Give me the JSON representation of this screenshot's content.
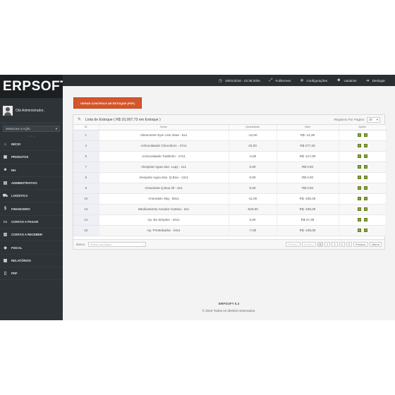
{
  "sidebar": {
    "logo": "ERPSOFT",
    "greeting": "Olá Administrador,",
    "action_select": "Selecione a Ação",
    "items": [
      {
        "label": "INÍCIO",
        "icon": "home-icon"
      },
      {
        "label": "PRODUTOS",
        "icon": "box-icon"
      },
      {
        "label": "RH",
        "icon": "users-icon"
      },
      {
        "label": "ADMINISTRATIVO",
        "icon": "briefcase-icon"
      },
      {
        "label": "LOGÍSTICA",
        "icon": "truck-icon"
      },
      {
        "label": "FINANCEIRO",
        "icon": "money-icon"
      },
      {
        "label": "CONTAS A PAGAR",
        "icon": "credit-card-icon"
      },
      {
        "label": "CONTAS A RECEBER",
        "icon": "wallet-icon"
      },
      {
        "label": "FISCAL",
        "icon": "tag-icon"
      },
      {
        "label": "RELATÓRIOS",
        "icon": "chart-icon"
      },
      {
        "label": "PDF",
        "icon": "file-icon"
      }
    ]
  },
  "topbar": {
    "datetime": "19/01/2016 - 22:36:20hs",
    "fullscreen": "FullScreen",
    "settings": "Configurações",
    "users": "Usuários",
    "logout": "Deslogar"
  },
  "main": {
    "pdf_button": "GERAR CONTROLE DE ESTOQUE (PDF)",
    "panel_title": "Lista de Estoque ( R$ 10,007.73 em Estoque )",
    "per_page_label": "Registros Por Pagina",
    "per_page_value": "10",
    "columns": [
      "ID",
      "Nome",
      "Quantidade",
      "Valor",
      "Ações"
    ],
    "rows": [
      {
        "id": "1",
        "nome": "Absorvente Sym com Abas - 6x1",
        "qtd": "-12,00",
        "valor": "R$ -14,28"
      },
      {
        "id": "4",
        "nome": "Achocolatado Chocobom - 27x1",
        "qtd": "22,00",
        "valor": "R$ 277,20"
      },
      {
        "id": "5",
        "nome": "Achocolatado Toddinho - 27x1",
        "qtd": "-4,00",
        "valor": "R$ -117,00"
      },
      {
        "id": "7",
        "nome": "Alvejante Agua San. Lupy - 1x1",
        "qtd": "0,00",
        "valor": "R$ 0,00"
      },
      {
        "id": "8",
        "nome": "Alvejante Agua San. Q.Boa - 12x1",
        "qtd": "0,00",
        "valor": "R$ 0,00"
      },
      {
        "id": "9",
        "nome": "Amaciante Q.Boa 2lt - 6x1",
        "qtd": "0,00",
        "valor": "R$ 0,00"
      },
      {
        "id": "10",
        "nome": "Amendoin 30g - 50x1",
        "qtd": "-11,00",
        "valor": "R$ -159,26"
      },
      {
        "id": "13",
        "nome": "Medicamento Amador Carteia - 2x1",
        "qtd": "-540,00",
        "valor": "R$ -349,29"
      },
      {
        "id": "14",
        "nome": "Ap. Bo Simples - 24x1",
        "qtd": "2,00",
        "valor": "R$ 27,48"
      },
      {
        "id": "15",
        "nome": "Ap. Prestobarba - 24x1",
        "qtd": "-7,00",
        "valor": "R$ -109,00"
      }
    ],
    "search_label": "Busca:",
    "search_placeholder": "Informe sua busca...",
    "pagination": {
      "first": "Primeiro",
      "prev": "Anterior",
      "pages": [
        "1",
        "2",
        "3",
        "4",
        "5"
      ],
      "next": "Próximo",
      "last": "Último"
    }
  },
  "footer": {
    "version": "ERPSOFT 5.3",
    "copyright": "© 2016 Todos os direitos reservados."
  }
}
